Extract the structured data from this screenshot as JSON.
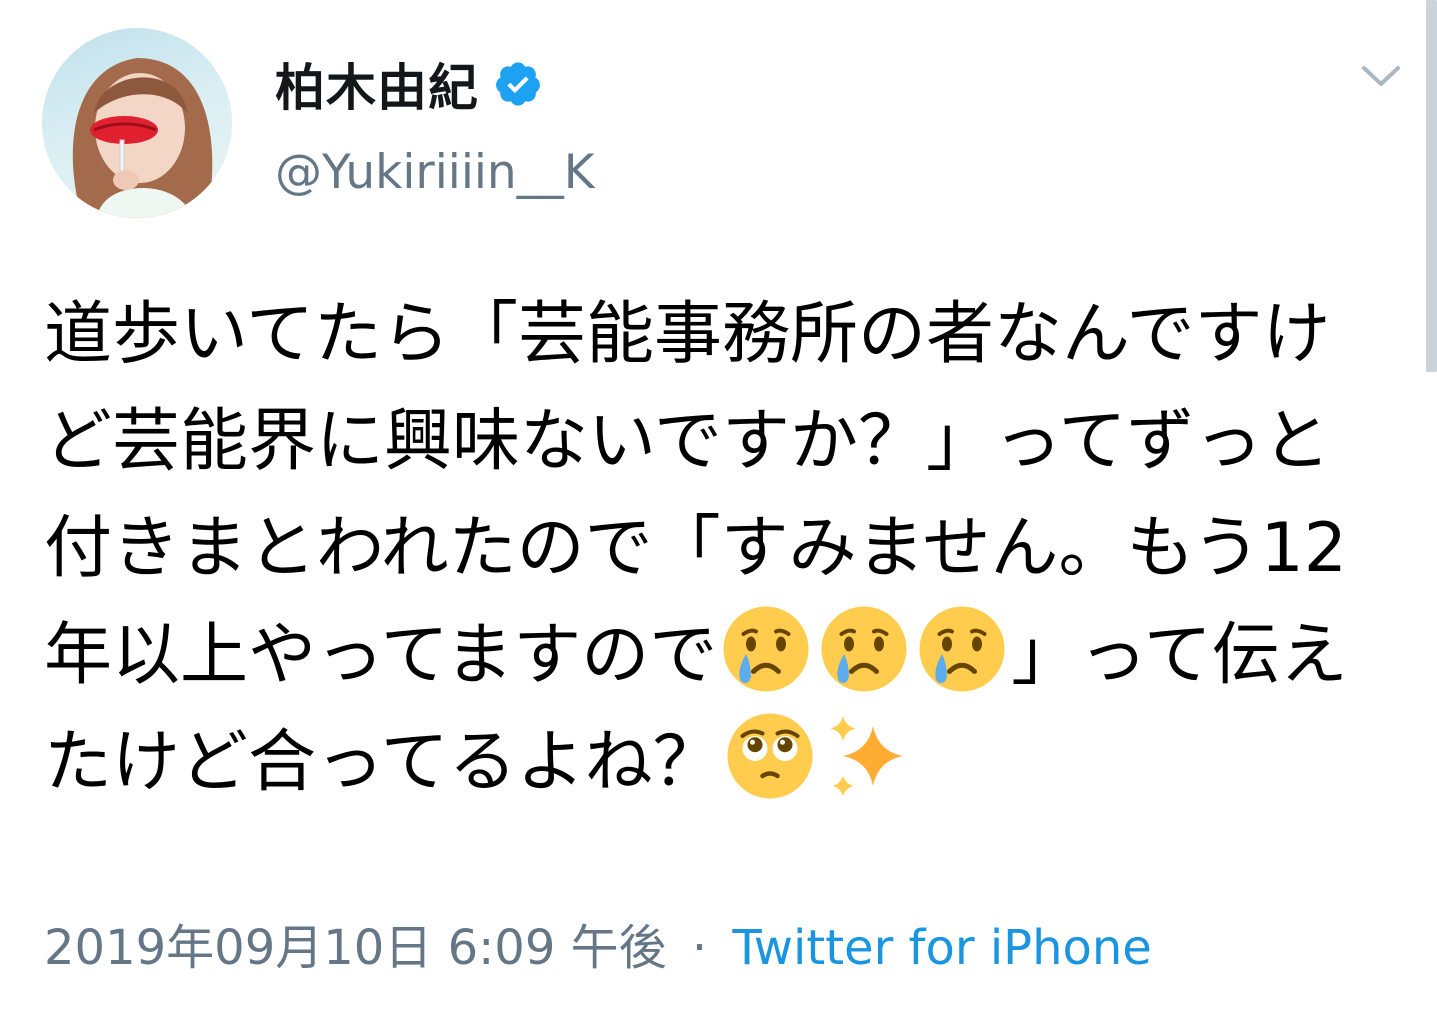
{
  "tweet": {
    "display_name": "柏木由紀",
    "handle": "@Yukiriiiin__K",
    "verified_icon": "verified-badge-icon",
    "menu_icon": "chevron-down-icon",
    "text_line1": "道歩いてたら「芸能事務所の者なんですけど芸能界に興味ないですか？」ってずっと付きまとわれたので「すみません。もう12年以上やってますので",
    "text_line2_after_emoji": "」って伝えたけど合ってるよね？",
    "emojis": [
      "crying-face-emoji",
      "crying-face-emoji",
      "crying-face-emoji",
      "face-holding-back-tears-emoji",
      "sparkles-emoji"
    ],
    "timestamp": "2019年09月10日 6:09 午後",
    "separator": "·",
    "source": "Twitter for iPhone"
  },
  "colors": {
    "accent": "#1b95e0",
    "secondary_text": "#657786",
    "primary_text": "#14171a",
    "verified": "#1da1f2"
  }
}
